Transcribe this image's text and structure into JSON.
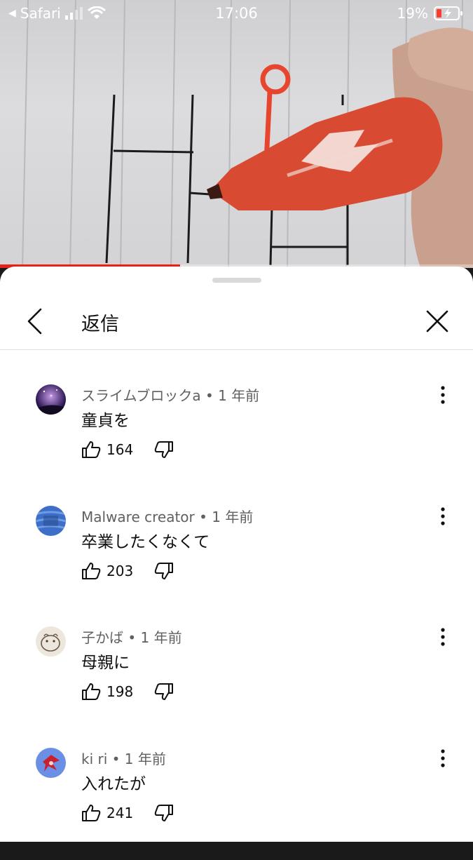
{
  "status_bar": {
    "back_app": "Safari",
    "time": "17:06",
    "battery": "19%"
  },
  "video": {
    "progress_fraction": 0.38,
    "progress_color": "#e62117"
  },
  "sheet": {
    "title": "返信",
    "icons": {
      "back": "chevron-left-icon",
      "close": "close-icon"
    }
  },
  "comments": [
    {
      "author": "スライムブロックa",
      "age": "1 年前",
      "text": "童貞を",
      "likes": "164"
    },
    {
      "author": "Malware creator",
      "age": "1 年前",
      "text": "卒業したくなくて",
      "likes": "203"
    },
    {
      "author": "子かば",
      "age": "1 年前",
      "text": "母親に",
      "likes": "198"
    },
    {
      "author": "ki ri",
      "age": "1 年前",
      "text": "入れたが",
      "likes": "241"
    }
  ]
}
